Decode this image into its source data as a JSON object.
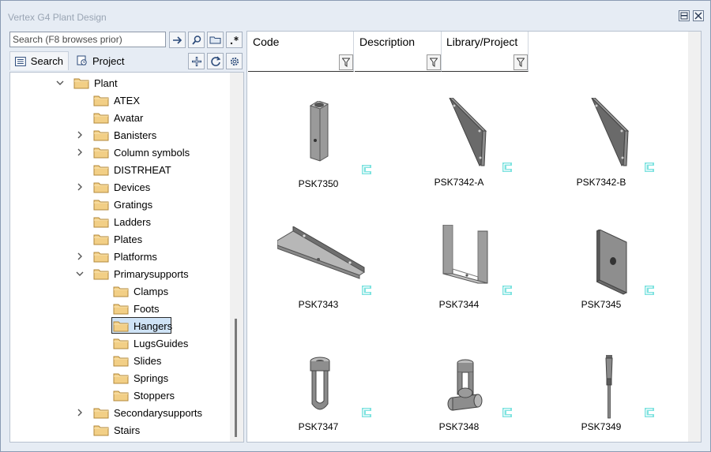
{
  "window": {
    "title": "Vertex G4 Plant Design"
  },
  "search": {
    "placeholder": "Search (F8 browses prior)"
  },
  "tabs": [
    {
      "label": "Search"
    },
    {
      "label": "Project"
    }
  ],
  "tree": {
    "items": [
      {
        "label": "Plant",
        "level": 0,
        "expander": "expanded"
      },
      {
        "label": "ATEX",
        "level": 1,
        "expander": "none"
      },
      {
        "label": "Avatar",
        "level": 1,
        "expander": "none"
      },
      {
        "label": "Banisters",
        "level": 1,
        "expander": "collapsed"
      },
      {
        "label": "Column symbols",
        "level": 1,
        "expander": "collapsed"
      },
      {
        "label": "DISTRHEAT",
        "level": 1,
        "expander": "none"
      },
      {
        "label": "Devices",
        "level": 1,
        "expander": "collapsed"
      },
      {
        "label": "Gratings",
        "level": 1,
        "expander": "none"
      },
      {
        "label": "Ladders",
        "level": 1,
        "expander": "none"
      },
      {
        "label": "Plates",
        "level": 1,
        "expander": "none"
      },
      {
        "label": "Platforms",
        "level": 1,
        "expander": "collapsed"
      },
      {
        "label": "Primarysupports",
        "level": 1,
        "expander": "expanded"
      },
      {
        "label": "Clamps",
        "level": 2,
        "expander": "none"
      },
      {
        "label": "Foots",
        "level": 2,
        "expander": "none"
      },
      {
        "label": "Hangers",
        "level": 2,
        "expander": "none",
        "selected": true
      },
      {
        "label": "LugsGuides",
        "level": 2,
        "expander": "none"
      },
      {
        "label": "Slides",
        "level": 2,
        "expander": "none"
      },
      {
        "label": "Springs",
        "level": 2,
        "expander": "none"
      },
      {
        "label": "Stoppers",
        "level": 2,
        "expander": "none"
      },
      {
        "label": "Secondarysupports",
        "level": 1,
        "expander": "collapsed"
      },
      {
        "label": "Stairs",
        "level": 1,
        "expander": "none"
      }
    ]
  },
  "columns": [
    {
      "label": "Code"
    },
    {
      "label": "Description"
    },
    {
      "label": "Library/Project"
    }
  ],
  "items": [
    {
      "code": "PSK7350",
      "shape": "hex-nut"
    },
    {
      "code": "PSK7342-A",
      "shape": "triangle-plate"
    },
    {
      "code": "PSK7342-B",
      "shape": "triangle-plate"
    },
    {
      "code": "PSK7343",
      "shape": "angle-bar"
    },
    {
      "code": "PSK7344",
      "shape": "u-channel"
    },
    {
      "code": "PSK7345",
      "shape": "lug-plate"
    },
    {
      "code": "PSK7347",
      "shape": "clevis"
    },
    {
      "code": "PSK7348",
      "shape": "pin-clevis"
    },
    {
      "code": "PSK7349",
      "shape": "rod"
    }
  ],
  "colors": {
    "badge": "#7fe3e0",
    "folder": "#f2cf86",
    "selection": "#cfe3f6"
  },
  "icons": {
    "toolbar": [
      "go-arrow-icon",
      "magnifier-icon",
      "open-folder-icon",
      "regex-icon"
    ],
    "tree_toolbar": [
      "add-icon",
      "refresh-icon",
      "gear-icon"
    ]
  }
}
